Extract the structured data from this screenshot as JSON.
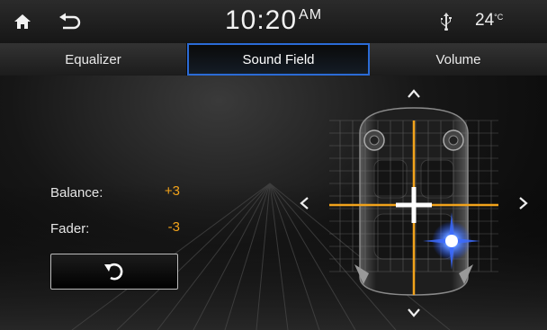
{
  "statusbar": {
    "home_icon": "home-icon",
    "back_icon": "back-arrow-icon",
    "time": "10:20",
    "ampm": "AM",
    "usb_icon": "usb-icon",
    "temperature": "24",
    "temperature_unit": "°C"
  },
  "tabs": [
    {
      "label": "Equalizer",
      "active": false
    },
    {
      "label": "Sound Field",
      "active": true
    },
    {
      "label": "Volume",
      "active": false
    }
  ],
  "sound_field": {
    "balance_label": "Balance:",
    "balance_value": "+3",
    "fader_label": "Fader:",
    "fader_value": "-3",
    "reset_icon": "reset-icon",
    "up_icon": "chevron-up-icon",
    "down_icon": "chevron-down-icon",
    "left_icon": "chevron-left-icon",
    "right_icon": "chevron-right-icon"
  },
  "colors": {
    "accent_orange": "#f2a31b",
    "active_tab_border": "#2b6bd6",
    "listener_dot": "#2f6cff"
  }
}
